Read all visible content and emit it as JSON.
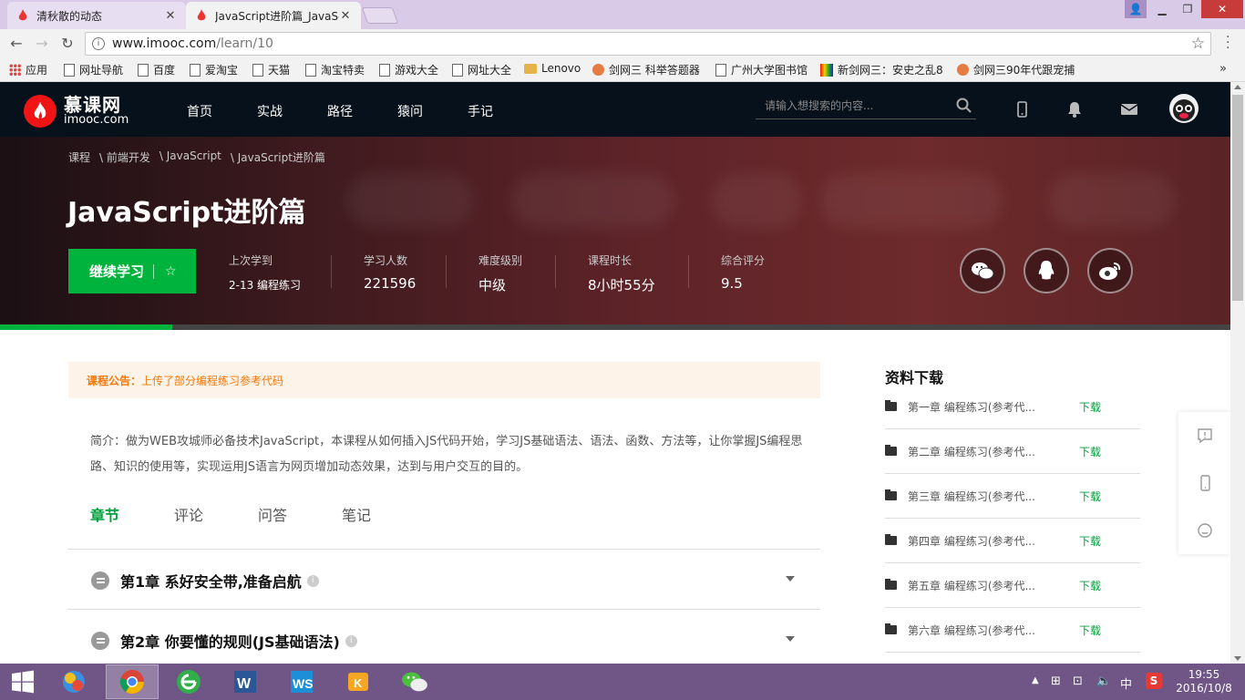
{
  "browser": {
    "tabs": [
      {
        "title": "清秋散的动态",
        "active": false
      },
      {
        "title": "JavaScript进阶篇_JavaSc",
        "active": true
      }
    ],
    "url_host": "www.imooc.com",
    "url_path": "/learn/10",
    "bookmarks": [
      {
        "label": "应用",
        "icon": "apps-grid-icon"
      },
      {
        "label": "网址导航",
        "icon": "page-icon"
      },
      {
        "label": "百度",
        "icon": "page-icon"
      },
      {
        "label": "爱淘宝",
        "icon": "page-icon"
      },
      {
        "label": "天猫",
        "icon": "page-icon"
      },
      {
        "label": "淘宝特卖",
        "icon": "page-icon"
      },
      {
        "label": "游戏大全",
        "icon": "page-icon"
      },
      {
        "label": "网址大全",
        "icon": "page-icon"
      },
      {
        "label": "Lenovo",
        "icon": "folder-icon"
      },
      {
        "label": "剑网三 科举答题器",
        "icon": "flower-icon"
      },
      {
        "label": "广州大学图书馆",
        "icon": "page-icon"
      },
      {
        "label": "新剑网三：安史之乱8",
        "icon": "colorful-icon"
      },
      {
        "label": "剑网三90年代跟宠捕",
        "icon": "flower-icon"
      }
    ]
  },
  "site": {
    "logo_cn": "慕课网",
    "logo_en": "imooc.com",
    "nav": [
      "首页",
      "实战",
      "路径",
      "猿问",
      "手记"
    ],
    "search_placeholder": "请输入想搜索的内容..."
  },
  "course": {
    "breadcrumb": [
      "课程",
      "\\ 前端开发",
      "\\ JavaScript",
      "\\ JavaScript进阶篇"
    ],
    "title": "JavaScript进阶篇",
    "continue_label": "继续学习",
    "stats": [
      {
        "label": "上次学到",
        "value": "2-13 编程练习"
      },
      {
        "label": "学习人数",
        "value": "221596"
      },
      {
        "label": "难度级别",
        "value": "中级"
      },
      {
        "label": "课程时长",
        "value": "8小时55分"
      },
      {
        "label": "综合评分",
        "value": "9.5"
      }
    ],
    "share_icons": [
      "wechat-icon",
      "qq-icon",
      "weibo-icon"
    ],
    "progress_fraction": 0.14
  },
  "notice": {
    "label": "课程公告：",
    "text": "上传了部分编程练习参考代码"
  },
  "intro": "简介：做为WEB攻城师必备技术JavaScript，本课程从如何插入JS代码开始，学习JS基础语法、语法、函数、方法等，让你掌握JS编程思路、知识的使用等，实现运用JS语言为网页增加动态效果，达到与用户交互的目的。",
  "content_tabs": [
    {
      "label": "章节",
      "active": true
    },
    {
      "label": "评论",
      "active": false
    },
    {
      "label": "问答",
      "active": false
    },
    {
      "label": "笔记",
      "active": false
    }
  ],
  "chapters": [
    {
      "title": "第1章 系好安全带,准备启航"
    },
    {
      "title": "第2章 你要懂的规则(JS基础语法)"
    }
  ],
  "downloads": {
    "title": "资料下载",
    "action_label": "下载",
    "items": [
      "第一章 编程练习(参考代...",
      "第二章 编程练习(参考代...",
      "第三章 编程练习(参考代...",
      "第四章 编程练习(参考代...",
      "第五章 编程练习(参考代...",
      "第六章 编程练习(参考代..."
    ]
  },
  "taskbar": {
    "apps": [
      "windows-start-icon",
      "browser-app-icon",
      "chrome-icon",
      "ie-like-icon",
      "word-icon",
      "ws-icon",
      "game-icon",
      "wechat-icon"
    ],
    "ime": "中",
    "time": "19:55",
    "date": "2016/10/8"
  },
  "colors": {
    "brand_green": "#00b33c",
    "brand_red": "#f01414",
    "notice_orange": "#f5780a"
  }
}
